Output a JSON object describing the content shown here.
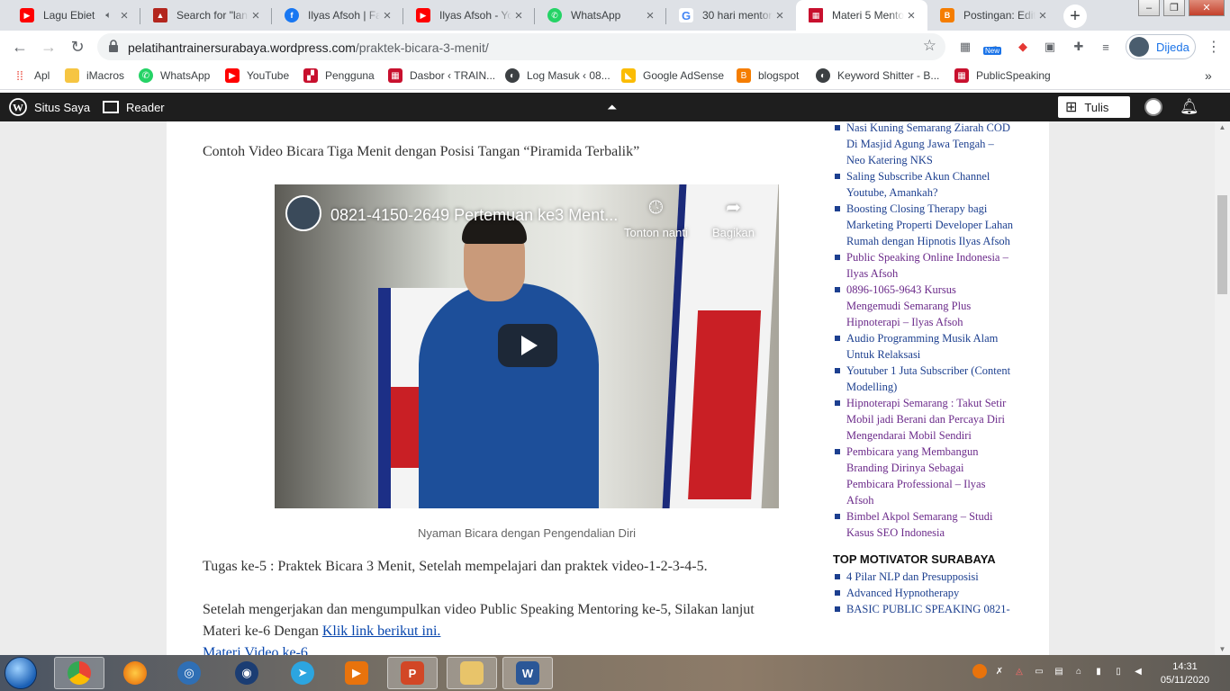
{
  "browser": {
    "tabs": [
      {
        "title": "Lagu Ebiet",
        "favicon": "youtube",
        "audio": true
      },
      {
        "title": "Search for \"lang",
        "favicon": "pdf-red"
      },
      {
        "title": "Ilyas Afsoh | Fac",
        "favicon": "facebook"
      },
      {
        "title": "Ilyas Afsoh - Yo",
        "favicon": "youtube"
      },
      {
        "title": "WhatsApp",
        "favicon": "whatsapp"
      },
      {
        "title": "30 hari mentor",
        "favicon": "google"
      },
      {
        "title": "Materi 5 Mento",
        "favicon": "site",
        "active": true
      },
      {
        "title": "Postingan: Edit",
        "favicon": "blogger"
      }
    ],
    "url_host": "pelatihantrainersurabaya.wordpress.com",
    "url_path": "/praktek-bicara-3-menit/",
    "profile_name": "Dijeda",
    "ext_badge": "New",
    "bookmarks": [
      "Apl",
      "iMacros",
      "WhatsApp",
      "YouTube",
      "Pengguna",
      "Dasbor ‹ TRAIN...",
      "Log Masuk ‹ 08...",
      "Google AdSense",
      "blogspot",
      "Keyword Shitter - B...",
      "PublicSpeaking"
    ]
  },
  "wpbar": {
    "site_label": "Situs Saya",
    "reader_label": "Reader",
    "write_label": "Tulis"
  },
  "article": {
    "intro": "Contoh Video Bicara Tiga Menit dengan Posisi Tangan “Piramida Terbalik”",
    "video_title": "0821-4150-2649 Pertemuan ke3 Ment...",
    "watch_later": "Tonton nanti",
    "share": "Bagikan",
    "caption": "Nyaman Bicara dengan Pengendalian Diri",
    "task": "Tugas ke-5 : Praktek Bicara 3 Menit, Setelah mempelajari dan praktek video-1-2-3-4-5.",
    "next_text": "Setelah mengerjakan dan mengumpulkan video Public Speaking Mentoring ke-5, Silakan lanjut Materi ke-6 Dengan ",
    "next_link": "Klik link berikut ini.",
    "next_video_link": "Materi Video ke-6"
  },
  "sidebar": {
    "recent_posts": [
      {
        "text": "Nasi Kuning Semarang Ziarah COD Di Masjid Agung Jawa Tengah – Neo Katering NKS",
        "visited": false
      },
      {
        "text": "Saling Subscribe Akun Channel Youtube, Amankah?",
        "visited": false
      },
      {
        "text": "Boosting Closing Therapy bagi Marketing Properti Developer Lahan Rumah dengan Hipnotis Ilyas Afsoh",
        "visited": false
      },
      {
        "text": "Public Speaking Online Indonesia – Ilyas Afsoh",
        "visited": true
      },
      {
        "text": "0896-1065-9643 Kursus Mengemudi Semarang Plus Hipnoterapi – Ilyas Afsoh",
        "visited": true
      },
      {
        "text": "Audio Programming Musik Alam Untuk Relaksasi",
        "visited": false
      },
      {
        "text": "Youtuber 1 Juta Subscriber (Content Modelling)",
        "visited": false
      },
      {
        "text": "Hipnoterapi Semarang : Takut Setir Mobil jadi Berani dan Percaya Diri Mengendarai Mobil Sendiri",
        "visited": true
      },
      {
        "text": "Pembicara yang Membangun Branding Dirinya Sebagai Pembicara Professional – Ilyas Afsoh",
        "visited": true
      },
      {
        "text": "Bimbel Akpol Semarang – Studi Kasus SEO Indonesia",
        "visited": true
      }
    ],
    "section2_title": "TOP MOTIVATOR SURABAYA",
    "section2_items": [
      "4 Pilar NLP dan Presupposisi",
      "Advanced Hypnotherapy",
      "BASIC PUBLIC SPEAKING 0821-"
    ]
  },
  "taskbar": {
    "time": "14:31",
    "date": "05/11/2020"
  },
  "colors": {
    "link": "#1c3f8f",
    "visited": "#6b2a8a",
    "wpbar": "#1e1e1e"
  }
}
